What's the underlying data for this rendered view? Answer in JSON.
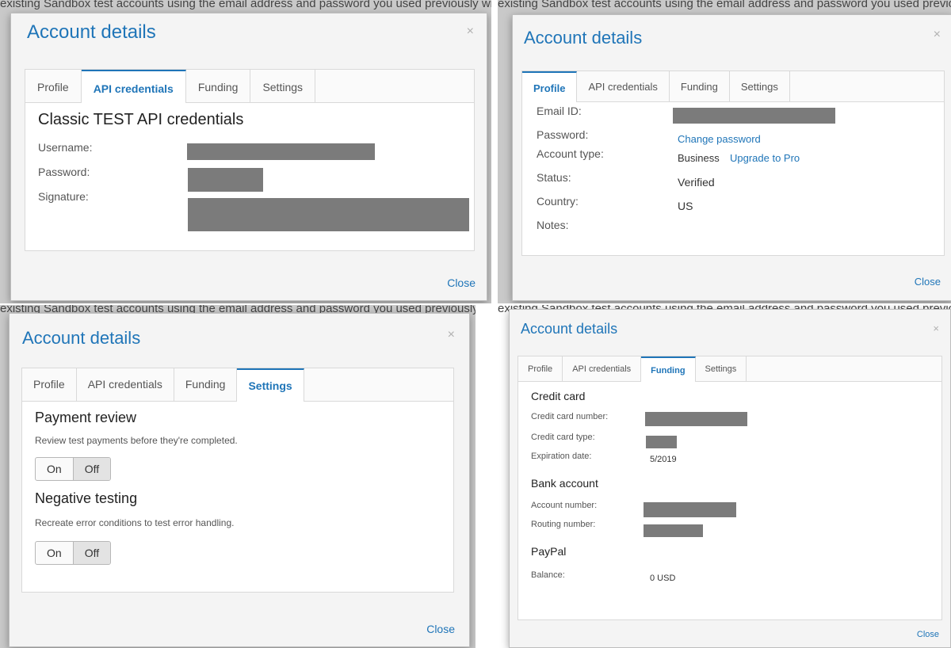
{
  "background": {
    "text": "existing Sandbox test accounts using the email address and password you used previously with the"
  },
  "modal_title": "Account details",
  "close_x": "×",
  "close_label": "Close",
  "tabs": [
    "Profile",
    "API credentials",
    "Funding",
    "Settings"
  ],
  "api_credentials": {
    "heading": "Classic TEST API credentials",
    "username_label": "Username:",
    "password_label": "Password:",
    "signature_label": "Signature:"
  },
  "profile": {
    "email_label": "Email ID:",
    "password_label": "Password:",
    "change_password": "Change password",
    "account_type_label": "Account type:",
    "account_type_value": "Business",
    "upgrade_link": "Upgrade to Pro",
    "status_label": "Status:",
    "status_value": "Verified",
    "country_label": "Country:",
    "country_value": "US",
    "notes_label": "Notes:"
  },
  "settings": {
    "payment_review_heading": "Payment review",
    "payment_review_desc": "Review test payments before they're completed.",
    "negative_testing_heading": "Negative testing",
    "negative_testing_desc": "Recreate error conditions to test error handling.",
    "on_label": "On",
    "off_label": "Off",
    "payment_review_selected": "Off",
    "negative_testing_selected": "Off"
  },
  "funding": {
    "credit_card_heading": "Credit card",
    "cc_number_label": "Credit card number:",
    "cc_type_label": "Credit card type:",
    "expiration_label": "Expiration date:",
    "expiration_value": "5/2019",
    "bank_heading": "Bank account",
    "account_number_label": "Account number:",
    "routing_number_label": "Routing number:",
    "paypal_heading": "PayPal",
    "balance_label": "Balance:",
    "balance_value": "0 USD"
  },
  "colors": {
    "accent": "#1f75b8",
    "redaction": "#7b7b7b"
  }
}
